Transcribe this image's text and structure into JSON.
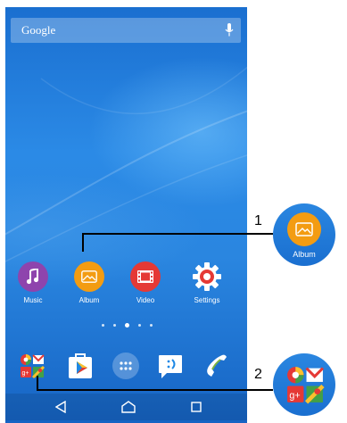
{
  "search": {
    "brand": "Google",
    "icons": [
      "mic-icon"
    ]
  },
  "apps": [
    {
      "label": "Music",
      "icon": "music-icon",
      "color": "#8e44ad"
    },
    {
      "label": "Album",
      "icon": "album-icon",
      "color": "#f39c12"
    },
    {
      "label": "Video",
      "icon": "video-icon",
      "color": "#e53935"
    },
    {
      "label": "Settings",
      "icon": "gear-icon",
      "color": "#e53935"
    }
  ],
  "page_indicator": {
    "pages": 5,
    "active": 3
  },
  "dock": [
    {
      "icon": "google-folder-icon"
    },
    {
      "icon": "play-store-icon"
    },
    {
      "icon": "app-drawer-icon"
    },
    {
      "icon": "messaging-icon"
    },
    {
      "icon": "phone-icon"
    }
  ],
  "navbar": {
    "icons": [
      "back-icon",
      "home-icon",
      "recents-icon"
    ]
  },
  "callouts": [
    {
      "number": "1",
      "zoom_label": "Album"
    },
    {
      "number": "2"
    }
  ]
}
